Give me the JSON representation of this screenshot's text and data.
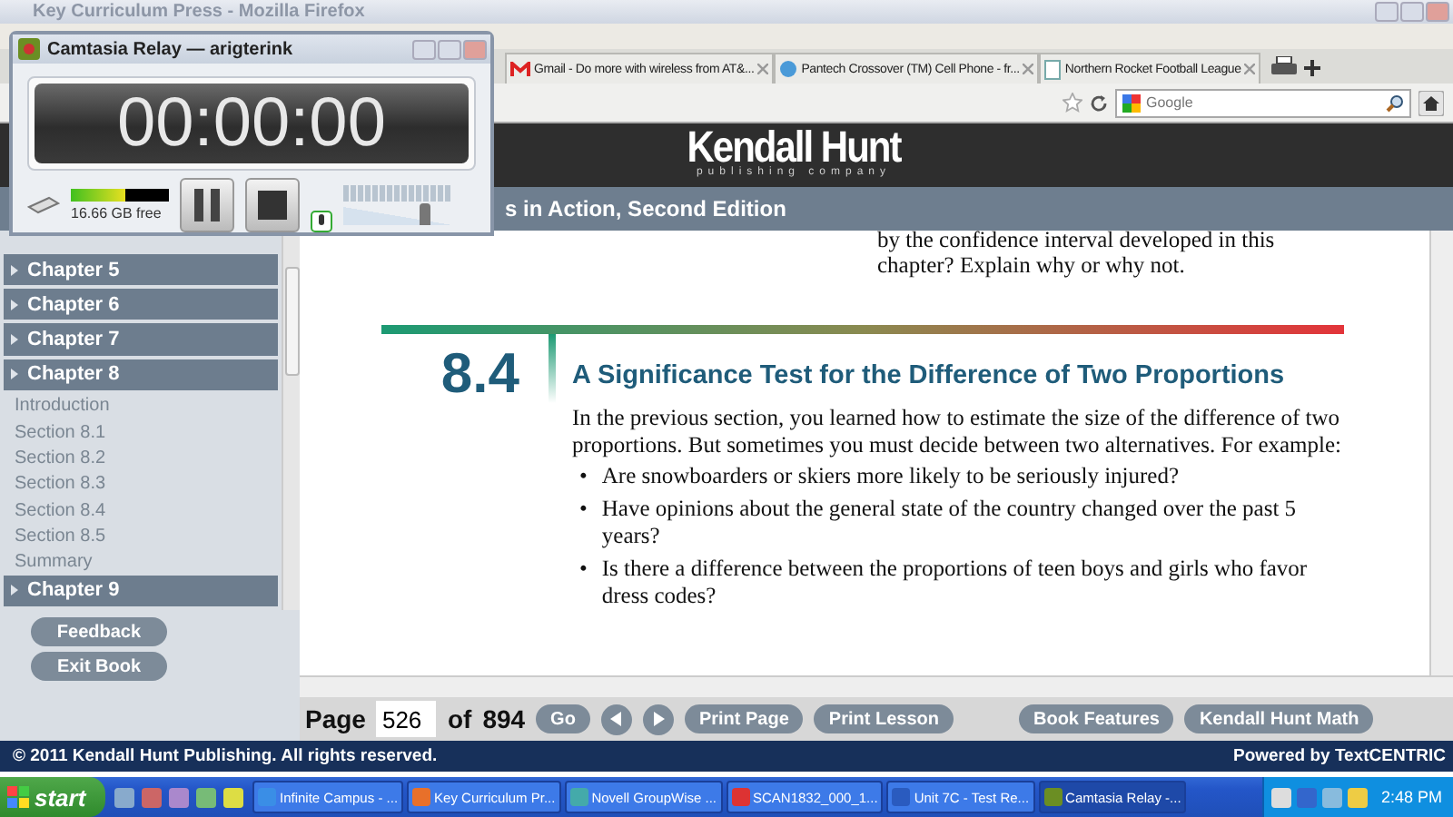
{
  "browser": {
    "title": "Key Curriculum Press - Mozilla Firefox",
    "tabs": [
      {
        "label": "Gmail - Do more with wireless from AT&...",
        "selected": false
      },
      {
        "label": "Pantech Crossover (TM) Cell Phone - fr...",
        "selected": false
      },
      {
        "label": "Northern Rocket Football League",
        "selected": false
      }
    ],
    "search": {
      "placeholder": "Google"
    }
  },
  "site": {
    "logo": "Kendall Hunt",
    "logo_tagline": "publishing company",
    "book_title": "s in Action, Second Edition",
    "sidebar": {
      "items": [
        {
          "label": "Chapter 5"
        },
        {
          "label": "Chapter 6"
        },
        {
          "label": "Chapter 7"
        },
        {
          "label": "Chapter 8",
          "children": [
            {
              "label": "Introduction"
            },
            {
              "label": "Section 8.1"
            },
            {
              "label": "Section 8.2"
            },
            {
              "label": "Section 8.3"
            },
            {
              "label": "Section 8.4"
            },
            {
              "label": "Section 8.5"
            },
            {
              "label": "Summary"
            }
          ]
        },
        {
          "label": "Chapter 9"
        }
      ],
      "buttons": [
        "Feedback",
        "Exit Book"
      ]
    },
    "content": {
      "prev_text": [
        "by the confidence interval developed in this",
        "chapter? Explain why or why not."
      ],
      "section_number": "8.4",
      "heading": "A Significance Test for the Difference of Two Proportions",
      "paragraph": "In the previous section, you learned how to estimate the size of the difference of two proportions. But sometimes you must decide between two alternatives. For example:",
      "bullets": [
        {
          "marker": "•",
          "text": "Are snowboarders or skiers more likely to be seriously injured?"
        },
        {
          "marker": "•",
          "text": "Have opinions about the general state of the country changed over the past 5 years?"
        },
        {
          "marker": "•",
          "text": "Is there a difference between the proportions of teen boys and girls who favor dress codes?"
        }
      ]
    },
    "toolbar": {
      "page_label": "Page",
      "page": "526",
      "of_label": "of",
      "total": "894",
      "go": "Go",
      "buttons": [
        "Print Page",
        "Print Lesson",
        "Book Features",
        "Kendall Hunt Math"
      ]
    },
    "footer": {
      "copyright": "© 2011 Kendall Hunt Publishing. All rights reserved.",
      "powered": "Powered by TextCENTRIC"
    }
  },
  "recorder": {
    "title": "Camtasia Relay — arigterink",
    "timer": "00:00:00",
    "disk": {
      "level": 0.55,
      "text": "16.66 GB free"
    },
    "volume": {
      "level": 0.75
    }
  },
  "taskbar": {
    "start": "start",
    "tasks": [
      {
        "label": "Infinite Campus - ...",
        "selected": false
      },
      {
        "label": "Key Curriculum Pr...",
        "selected": false
      },
      {
        "label": "Novell GroupWise ...",
        "selected": false
      },
      {
        "label": "SCAN1832_000_1...",
        "selected": false
      },
      {
        "label": "Unit 7C - Test Re...",
        "selected": false
      },
      {
        "label": "Camtasia Relay -...",
        "selected": true
      }
    ],
    "clock": "2:48 PM"
  }
}
